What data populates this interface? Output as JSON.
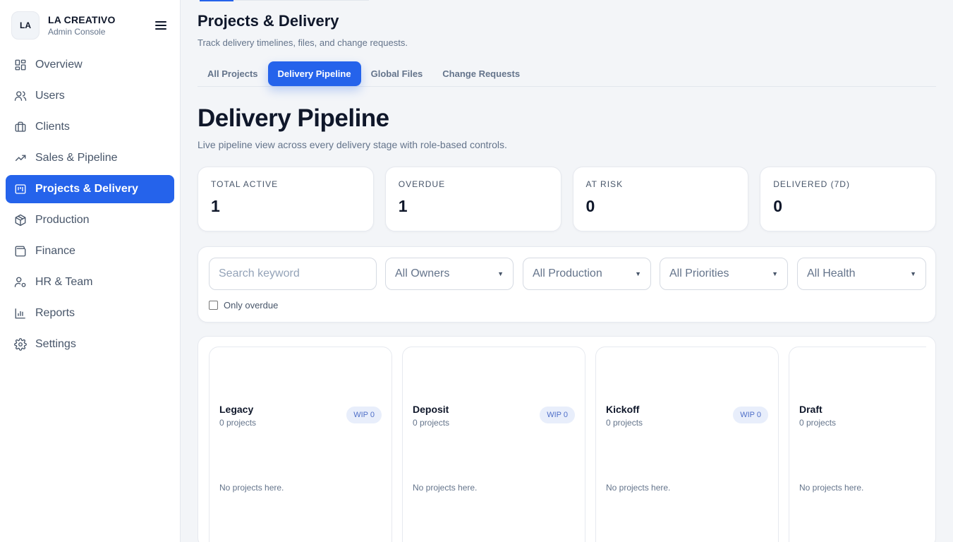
{
  "brand": {
    "badge": "LA",
    "name": "LA CREATIVO",
    "subtitle": "Admin Console"
  },
  "sidebar": {
    "items": [
      {
        "label": "Overview",
        "icon": "grid-icon",
        "active": false
      },
      {
        "label": "Users",
        "icon": "users-icon",
        "active": false
      },
      {
        "label": "Clients",
        "icon": "briefcase-icon",
        "active": false
      },
      {
        "label": "Sales & Pipeline",
        "icon": "trending-up-icon",
        "active": false
      },
      {
        "label": "Projects & Delivery",
        "icon": "kanban-icon",
        "active": true
      },
      {
        "label": "Production",
        "icon": "package-icon",
        "active": false
      },
      {
        "label": "Finance",
        "icon": "wallet-icon",
        "active": false
      },
      {
        "label": "HR & Team",
        "icon": "user-cog-icon",
        "active": false
      },
      {
        "label": "Reports",
        "icon": "bar-chart-icon",
        "active": false
      },
      {
        "label": "Settings",
        "icon": "gear-icon",
        "active": false
      }
    ]
  },
  "header": {
    "title": "Projects & Delivery",
    "subtitle": "Track delivery timelines, files, and change requests."
  },
  "tabs": [
    {
      "label": "All Projects",
      "active": false
    },
    {
      "label": "Delivery Pipeline",
      "active": true
    },
    {
      "label": "Global Files",
      "active": false
    },
    {
      "label": "Change Requests",
      "active": false
    }
  ],
  "section": {
    "title": "Delivery Pipeline",
    "subtitle": "Live pipeline view across every delivery stage with role-based controls."
  },
  "stats": [
    {
      "label": "TOTAL ACTIVE",
      "value": "1"
    },
    {
      "label": "OVERDUE",
      "value": "1"
    },
    {
      "label": "AT RISK",
      "value": "0"
    },
    {
      "label": "DELIVERED (7D)",
      "value": "0"
    }
  ],
  "filters": {
    "search_placeholder": "Search keyword",
    "owners": "All Owners",
    "production": "All Production",
    "priorities": "All Priorities",
    "health": "All Health",
    "only_overdue": "Only overdue"
  },
  "columns": [
    {
      "name": "Legacy",
      "count": "0 projects",
      "wip": "WIP 0",
      "empty": "No projects here."
    },
    {
      "name": "Deposit",
      "count": "0 projects",
      "wip": "WIP 0",
      "empty": "No projects here."
    },
    {
      "name": "Kickoff",
      "count": "0 projects",
      "wip": "WIP 0",
      "empty": "No projects here."
    },
    {
      "name": "Draft",
      "count": "0 projects",
      "wip": "",
      "empty": "No projects here."
    }
  ],
  "colors": {
    "accent": "#2563eb",
    "background": "#f3f5f8",
    "wip_bg": "#e8eefb"
  }
}
